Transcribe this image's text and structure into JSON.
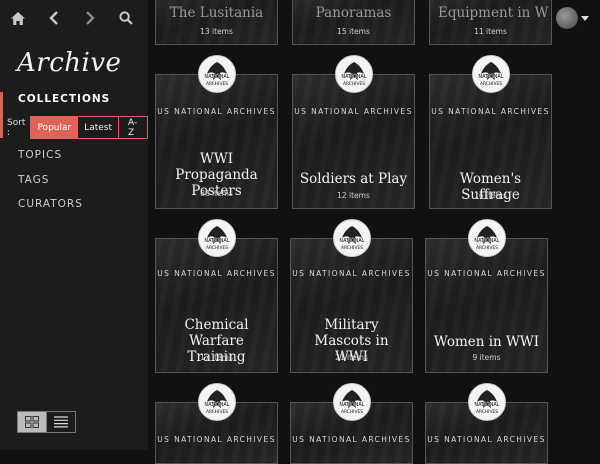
{
  "app": {
    "logo": "Archive"
  },
  "nav": {
    "sections": [
      "COLLECTIONS",
      "TOPICS",
      "TAGS",
      "CURATORS"
    ]
  },
  "sort": {
    "label": "Sort :",
    "options": [
      "Popular",
      "Latest",
      "A-Z"
    ],
    "selected": "Popular"
  },
  "header": {
    "help_label": "?"
  },
  "top_row": [
    {
      "title": "The Lusitania",
      "count": "13 items"
    },
    {
      "title": "Panoramas",
      "count": "15 items"
    },
    {
      "title": "Equipment in W",
      "count": "11 items"
    }
  ],
  "collections": [
    {
      "source": "US NATIONAL ARCHIVES",
      "title_lines": [
        "WWI Propaganda",
        "Posters"
      ],
      "count": "88 items"
    },
    {
      "source": "US NATIONAL ARCHIVES",
      "title_lines": [
        "Soldiers at Play"
      ],
      "count": "12 items"
    },
    {
      "source": "US NATIONAL ARCHIVES",
      "title_lines": [
        "Women's Suffrage"
      ],
      "count": "16 items"
    },
    {
      "source": "US NATIONAL ARCHIVES",
      "title_lines": [
        "Chemical Warfare",
        "Training"
      ],
      "count": "17 items"
    },
    {
      "source": "US NATIONAL ARCHIVES",
      "title_lines": [
        "Military Mascots in",
        "WWI"
      ],
      "count": "21 items"
    },
    {
      "source": "US NATIONAL ARCHIVES",
      "title_lines": [
        "Women in WWI"
      ],
      "count": "9 items"
    }
  ],
  "bottom_row": [
    {
      "source": "US NATIONAL ARCHIVES"
    },
    {
      "source": "US NATIONAL ARCHIVES"
    },
    {
      "source": "US NATIONAL ARCHIVES"
    }
  ],
  "seal_text": "NATIONAL ARCHIVES",
  "colors": {
    "accent": "#e0605a",
    "background": "#111111",
    "sidebar": "#1c1c1c"
  }
}
